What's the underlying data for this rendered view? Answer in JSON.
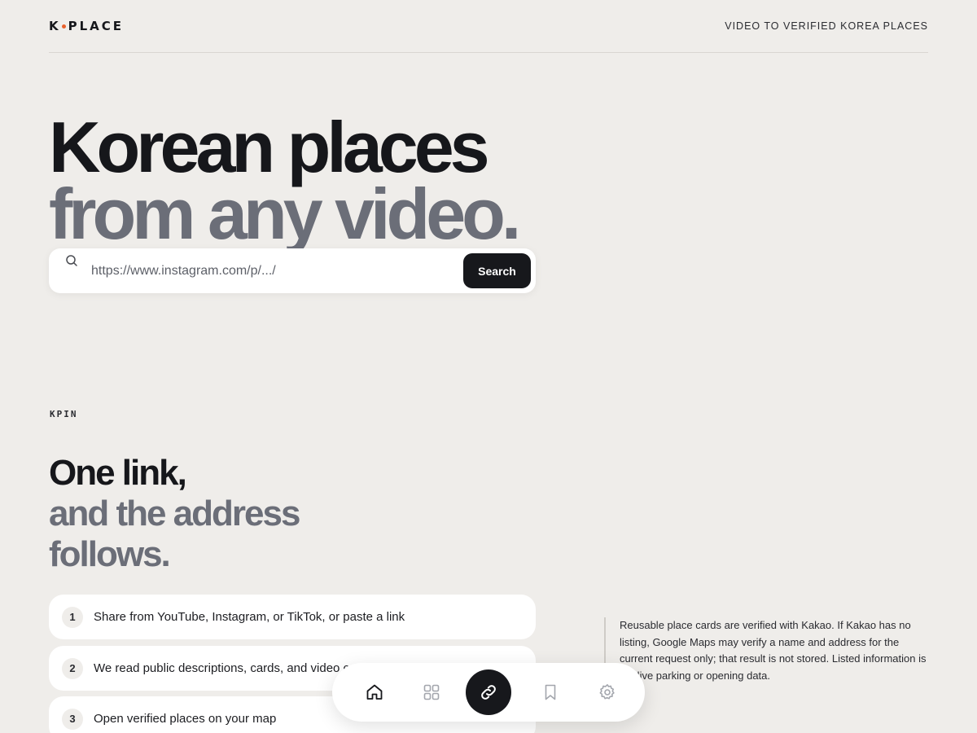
{
  "header": {
    "logo_left": "K",
    "logo_right": "PLACE",
    "tagline": "VIDEO TO VERIFIED KOREA PLACES"
  },
  "hero": {
    "line1": "Korean places",
    "line2": "from any video."
  },
  "search": {
    "placeholder": "https://www.instagram.com/p/.../",
    "value": "",
    "button_label": "Search"
  },
  "section": {
    "eyebrow": "KPIN",
    "title_line1": "One link,",
    "title_line2": "and the address",
    "title_line3": "follows.",
    "steps": [
      {
        "num": "1",
        "text": "Share from YouTube, Instagram, or TikTok, or paste a link"
      },
      {
        "num": "2",
        "text": "We read public descriptions, cards, and video c"
      },
      {
        "num": "3",
        "text": "Open verified places on your map"
      }
    ],
    "note": "Reusable place cards are verified with Kakao. If Kakao has no listing, Google Maps may verify a name and address for the current request only; that result is not stored. Listed information is not live parking or opening data."
  },
  "nav": {
    "items": [
      {
        "icon": "home-icon"
      },
      {
        "icon": "grid-icon"
      },
      {
        "icon": "link-icon",
        "active": true
      },
      {
        "icon": "bookmark-icon"
      },
      {
        "icon": "gear-icon"
      }
    ]
  },
  "colors": {
    "background": "#efedea",
    "primary_text": "#16171b",
    "muted_text": "#6b6e78",
    "accent_dot": "#e8602c",
    "button_dark": "#17181c"
  }
}
